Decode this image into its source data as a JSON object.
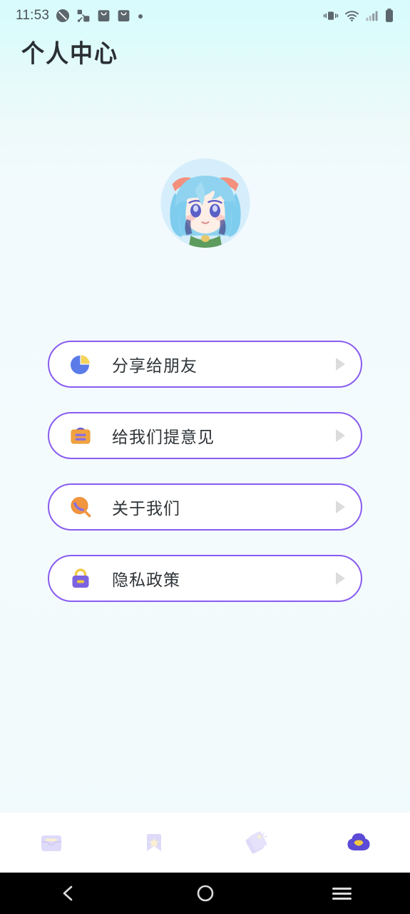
{
  "statusbar": {
    "time": "11:53",
    "left_icons": [
      "alarm-clock-icon",
      "network-share-icon",
      "inbox-app-icon",
      "inbox-app-icon-2",
      "dot-indicator-icon"
    ],
    "right_icons": [
      "vibrate-icon",
      "wifi-icon",
      "cellular-signal-icon",
      "battery-icon"
    ]
  },
  "header": {
    "title": "个人中心"
  },
  "profile": {
    "avatar_alt": "anime-avatar-blue-hair"
  },
  "menu": {
    "items": [
      {
        "id": "share",
        "label": "分享给朋友",
        "icon": "pie-chart-icon",
        "arrow": "chevron-right-icon"
      },
      {
        "id": "feedback",
        "label": "给我们提意见",
        "icon": "feedback-board-icon",
        "arrow": "chevron-right-icon"
      },
      {
        "id": "about",
        "label": "关于我们",
        "icon": "magnifier-icon",
        "arrow": "chevron-right-icon"
      },
      {
        "id": "privacy",
        "label": "隐私政策",
        "icon": "lock-icon",
        "arrow": "chevron-right-icon"
      }
    ]
  },
  "tabbar": {
    "items": [
      {
        "id": "inbox",
        "icon": "inbox-box-icon",
        "active": false
      },
      {
        "id": "favorites",
        "icon": "bookmark-star-icon",
        "active": false
      },
      {
        "id": "tags",
        "icon": "price-tag-icon",
        "active": false
      },
      {
        "id": "profile",
        "icon": "cloud-face-icon",
        "active": true
      }
    ]
  },
  "navbar": {
    "back": "back-chevron-icon",
    "home": "home-circle-icon",
    "recents": "recents-menu-icon"
  },
  "colors": {
    "accent_purple": "#8a5cf0",
    "tab_inactive": "#d8d5f7",
    "tab_active": "#5b4bd6",
    "bg_top": "#d8fbfd",
    "bg_bottom": "#f2fafd",
    "title_text": "#2a2f33",
    "label_text": "#2f3438",
    "arrow_grey": "#dcdcdc"
  }
}
